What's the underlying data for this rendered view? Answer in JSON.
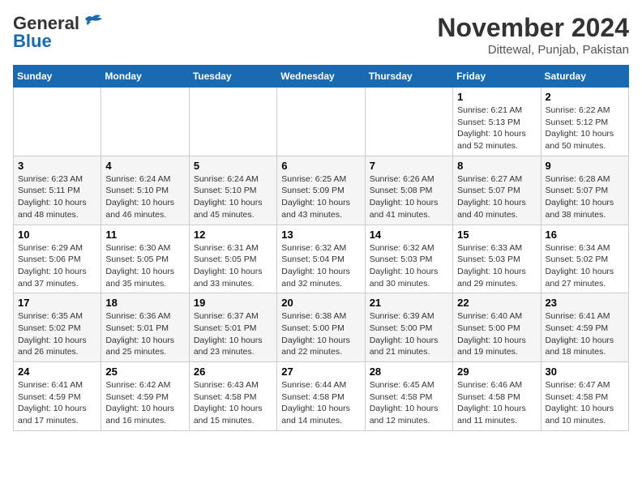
{
  "header": {
    "logo_general": "General",
    "logo_blue": "Blue",
    "month_title": "November 2024",
    "location": "Dittewal, Punjab, Pakistan"
  },
  "days_of_week": [
    "Sunday",
    "Monday",
    "Tuesday",
    "Wednesday",
    "Thursday",
    "Friday",
    "Saturday"
  ],
  "weeks": [
    [
      {
        "day": "",
        "content": ""
      },
      {
        "day": "",
        "content": ""
      },
      {
        "day": "",
        "content": ""
      },
      {
        "day": "",
        "content": ""
      },
      {
        "day": "",
        "content": ""
      },
      {
        "day": "1",
        "content": "Sunrise: 6:21 AM\nSunset: 5:13 PM\nDaylight: 10 hours and 52 minutes."
      },
      {
        "day": "2",
        "content": "Sunrise: 6:22 AM\nSunset: 5:12 PM\nDaylight: 10 hours and 50 minutes."
      }
    ],
    [
      {
        "day": "3",
        "content": "Sunrise: 6:23 AM\nSunset: 5:11 PM\nDaylight: 10 hours and 48 minutes."
      },
      {
        "day": "4",
        "content": "Sunrise: 6:24 AM\nSunset: 5:10 PM\nDaylight: 10 hours and 46 minutes."
      },
      {
        "day": "5",
        "content": "Sunrise: 6:24 AM\nSunset: 5:10 PM\nDaylight: 10 hours and 45 minutes."
      },
      {
        "day": "6",
        "content": "Sunrise: 6:25 AM\nSunset: 5:09 PM\nDaylight: 10 hours and 43 minutes."
      },
      {
        "day": "7",
        "content": "Sunrise: 6:26 AM\nSunset: 5:08 PM\nDaylight: 10 hours and 41 minutes."
      },
      {
        "day": "8",
        "content": "Sunrise: 6:27 AM\nSunset: 5:07 PM\nDaylight: 10 hours and 40 minutes."
      },
      {
        "day": "9",
        "content": "Sunrise: 6:28 AM\nSunset: 5:07 PM\nDaylight: 10 hours and 38 minutes."
      }
    ],
    [
      {
        "day": "10",
        "content": "Sunrise: 6:29 AM\nSunset: 5:06 PM\nDaylight: 10 hours and 37 minutes."
      },
      {
        "day": "11",
        "content": "Sunrise: 6:30 AM\nSunset: 5:05 PM\nDaylight: 10 hours and 35 minutes."
      },
      {
        "day": "12",
        "content": "Sunrise: 6:31 AM\nSunset: 5:05 PM\nDaylight: 10 hours and 33 minutes."
      },
      {
        "day": "13",
        "content": "Sunrise: 6:32 AM\nSunset: 5:04 PM\nDaylight: 10 hours and 32 minutes."
      },
      {
        "day": "14",
        "content": "Sunrise: 6:32 AM\nSunset: 5:03 PM\nDaylight: 10 hours and 30 minutes."
      },
      {
        "day": "15",
        "content": "Sunrise: 6:33 AM\nSunset: 5:03 PM\nDaylight: 10 hours and 29 minutes."
      },
      {
        "day": "16",
        "content": "Sunrise: 6:34 AM\nSunset: 5:02 PM\nDaylight: 10 hours and 27 minutes."
      }
    ],
    [
      {
        "day": "17",
        "content": "Sunrise: 6:35 AM\nSunset: 5:02 PM\nDaylight: 10 hours and 26 minutes."
      },
      {
        "day": "18",
        "content": "Sunrise: 6:36 AM\nSunset: 5:01 PM\nDaylight: 10 hours and 25 minutes."
      },
      {
        "day": "19",
        "content": "Sunrise: 6:37 AM\nSunset: 5:01 PM\nDaylight: 10 hours and 23 minutes."
      },
      {
        "day": "20",
        "content": "Sunrise: 6:38 AM\nSunset: 5:00 PM\nDaylight: 10 hours and 22 minutes."
      },
      {
        "day": "21",
        "content": "Sunrise: 6:39 AM\nSunset: 5:00 PM\nDaylight: 10 hours and 21 minutes."
      },
      {
        "day": "22",
        "content": "Sunrise: 6:40 AM\nSunset: 5:00 PM\nDaylight: 10 hours and 19 minutes."
      },
      {
        "day": "23",
        "content": "Sunrise: 6:41 AM\nSunset: 4:59 PM\nDaylight: 10 hours and 18 minutes."
      }
    ],
    [
      {
        "day": "24",
        "content": "Sunrise: 6:41 AM\nSunset: 4:59 PM\nDaylight: 10 hours and 17 minutes."
      },
      {
        "day": "25",
        "content": "Sunrise: 6:42 AM\nSunset: 4:59 PM\nDaylight: 10 hours and 16 minutes."
      },
      {
        "day": "26",
        "content": "Sunrise: 6:43 AM\nSunset: 4:58 PM\nDaylight: 10 hours and 15 minutes."
      },
      {
        "day": "27",
        "content": "Sunrise: 6:44 AM\nSunset: 4:58 PM\nDaylight: 10 hours and 14 minutes."
      },
      {
        "day": "28",
        "content": "Sunrise: 6:45 AM\nSunset: 4:58 PM\nDaylight: 10 hours and 12 minutes."
      },
      {
        "day": "29",
        "content": "Sunrise: 6:46 AM\nSunset: 4:58 PM\nDaylight: 10 hours and 11 minutes."
      },
      {
        "day": "30",
        "content": "Sunrise: 6:47 AM\nSunset: 4:58 PM\nDaylight: 10 hours and 10 minutes."
      }
    ]
  ]
}
